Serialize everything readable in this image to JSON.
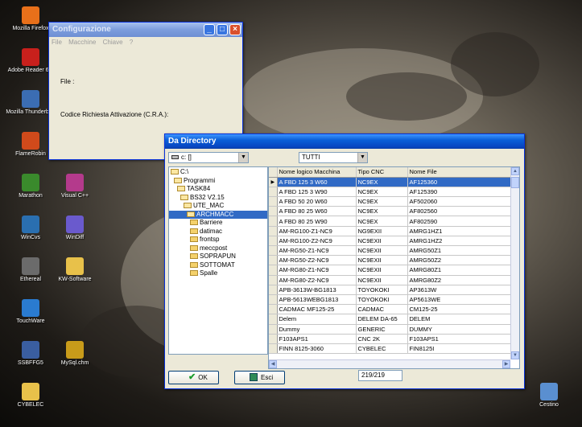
{
  "desktop": {
    "icons": [
      {
        "label": "Mozilla Firefox",
        "icon": "firefox-icon",
        "color": "#e8701a"
      },
      {
        "label": "Adobe Reader 6.0",
        "icon": "adobe-reader-icon",
        "color": "#c8201c"
      },
      {
        "label": "Mozilla Thunderbird",
        "icon": "thunderbird-icon",
        "color": "#3b6db3"
      },
      {
        "label": "FlameRobin",
        "icon": "flamerobin-icon",
        "color": "#d04a1b"
      },
      {
        "label": "Marathon",
        "icon": "marathon-icon",
        "color": "#3a8a2c"
      },
      {
        "label": "Visual C++",
        "icon": "visual-cpp-icon",
        "color": "#b43a8c"
      },
      {
        "label": "WinCvs",
        "icon": "wincvs-icon",
        "color": "#2a6fb0"
      },
      {
        "label": "WinDiff",
        "icon": "windiff-icon",
        "color": "#6a5acd"
      },
      {
        "label": "Ethereal",
        "icon": "ethereal-icon",
        "color": "#6b6b6b"
      },
      {
        "label": "KW-Software",
        "icon": "folder-icon",
        "color": "#e8c14a"
      },
      {
        "label": "TouchWare",
        "icon": "touchware-icon",
        "color": "#2a7bd0"
      },
      {
        "label": "SSBFFG5",
        "icon": "ssbffg5-icon",
        "color": "#3a5ea0"
      },
      {
        "label": "MySql.chm",
        "icon": "help-file-icon",
        "color": "#c89b1a"
      },
      {
        "label": "CYBELEC",
        "icon": "folder-icon",
        "color": "#e8c14a"
      },
      {
        "label": "Cestino",
        "icon": "recycle-bin-icon",
        "color": "#5a8fd0"
      }
    ]
  },
  "config_window": {
    "title": "Configurazione",
    "menu": [
      "File",
      "Macchine",
      "Chiave",
      "?"
    ],
    "file_label": "File :",
    "cra_label": "Codice Richiesta Attivazione (C.R.A.):"
  },
  "dir_window": {
    "title": "Da Directory",
    "drive": "c: []",
    "filter": "TUTTI",
    "tree": [
      {
        "label": "C:\\",
        "level": 0,
        "open": true
      },
      {
        "label": "Programmi",
        "level": 1,
        "open": true
      },
      {
        "label": "TASK84",
        "level": 2,
        "open": true
      },
      {
        "label": "BS32 V2.15",
        "level": 3,
        "open": true
      },
      {
        "label": "UTE_MAC",
        "level": 4,
        "open": true
      },
      {
        "label": "ARCHMACC",
        "level": 5,
        "open": true,
        "selected": true
      },
      {
        "label": "Barriere",
        "level": 6,
        "open": false
      },
      {
        "label": "datimac",
        "level": 6,
        "open": false
      },
      {
        "label": "frontsp",
        "level": 6,
        "open": false
      },
      {
        "label": "meccpost",
        "level": 6,
        "open": false
      },
      {
        "label": "SOPRAPUN",
        "level": 6,
        "open": false
      },
      {
        "label": "SOTTOMAT",
        "level": 6,
        "open": false
      },
      {
        "label": "Spalle",
        "level": 6,
        "open": false
      }
    ],
    "columns": [
      "Nome logico Macchina",
      "Tipo CNC",
      "Nome File"
    ],
    "rows": [
      [
        "A FBD 125 3 W60",
        "NC9EX",
        "AF125360"
      ],
      [
        "A FBD 125 3 W90",
        "NC9EX",
        "AF125390"
      ],
      [
        "A FBD 50 20 W60",
        "NC9EX",
        "AF502060"
      ],
      [
        "A FBD 80 25 W60",
        "NC9EX",
        "AF802560"
      ],
      [
        "A FBD 80 25 W90",
        "NC9EX",
        "AF802590"
      ],
      [
        "AM-RG100-Z1-NC9",
        "NG9EXII",
        "AMRG1HZ1"
      ],
      [
        "AM-RG100-Z2-NC9",
        "NC9EXII",
        "AMRG1HZ2"
      ],
      [
        "AM-RG50-Z1-NC9",
        "NC9EXII",
        "AMRG50Z1"
      ],
      [
        "AM-RG50-Z2-NC9",
        "NC9EXII",
        "AMRG50Z2"
      ],
      [
        "AM-RG80-Z1-NC9",
        "NC9EXII",
        "AMRG80Z1"
      ],
      [
        "AM-RG80-Z2-NC9",
        "NC9EXII",
        "AMRG80Z2"
      ],
      [
        "APB-3613W-BG1813",
        "TOYOKOKI",
        "AP3613W"
      ],
      [
        "APB-5613WEBG1813",
        "TOYOKOKI",
        "AP5613WE"
      ],
      [
        "CADMAC MF125-25",
        "CADMAC",
        "CM125-25"
      ],
      [
        "Delem",
        "DELEM DA-65",
        "DELEM"
      ],
      [
        "Dummy",
        "GENERIC",
        "DUMMY"
      ],
      [
        "F103APS1",
        "CNC 2K",
        "F103APS1"
      ],
      [
        "FINN 8125-3060",
        "CYBELEC",
        "FIN8125I"
      ]
    ],
    "ok_label": "OK",
    "exit_label": "Esci",
    "counter": "219/219"
  }
}
